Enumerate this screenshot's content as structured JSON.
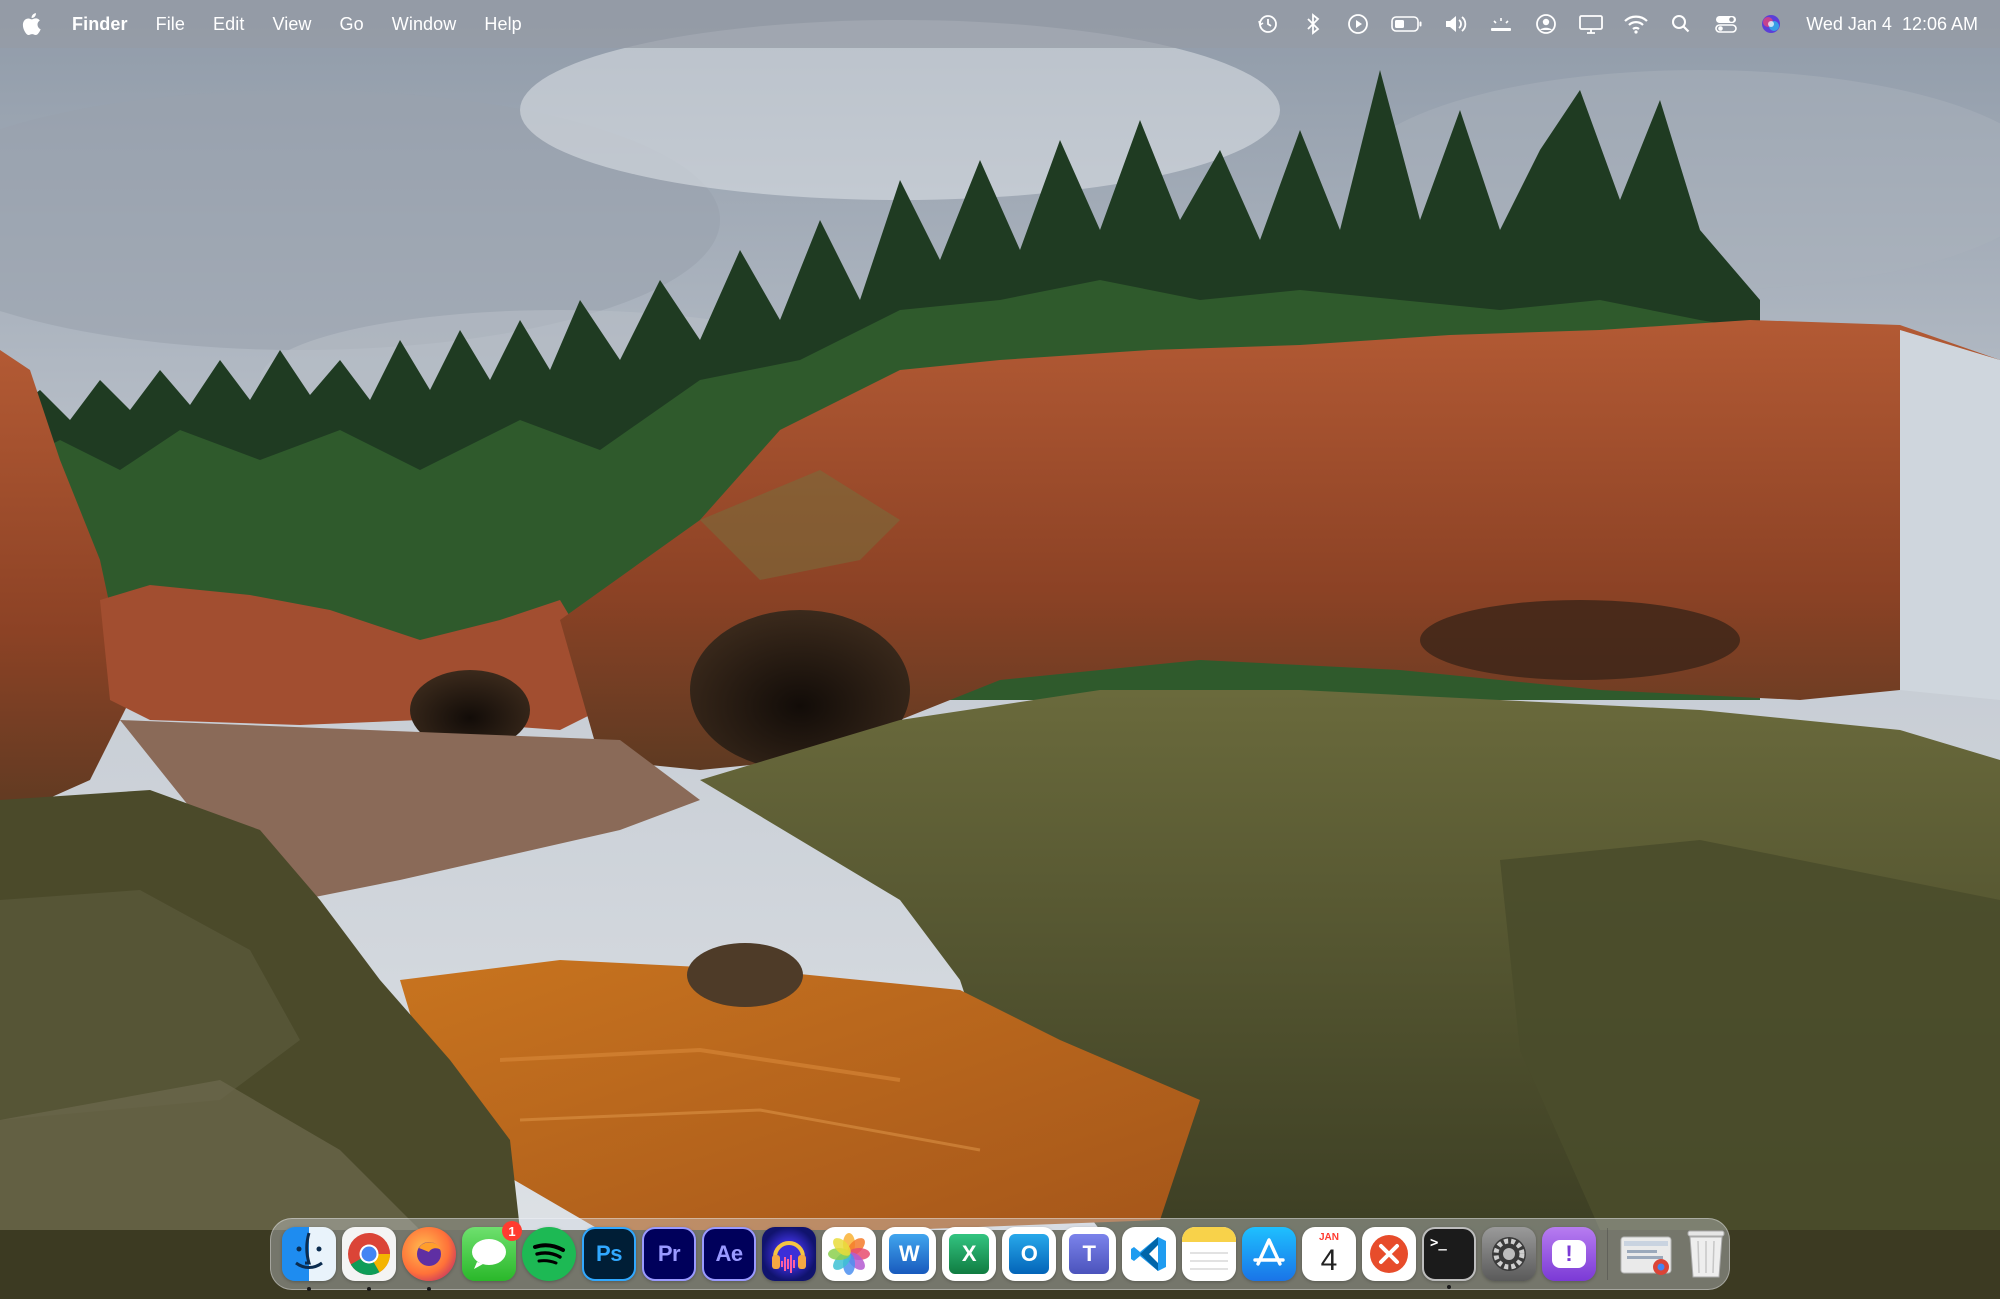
{
  "menubar": {
    "apple_icon": "apple-logo-icon",
    "app_name": "Finder",
    "menus": [
      "File",
      "Edit",
      "View",
      "Go",
      "Window",
      "Help"
    ],
    "status_icons": [
      "time-machine-icon",
      "bluetooth-icon",
      "play-circle-icon",
      "battery-icon",
      "volume-icon",
      "keyboard-brightness-icon",
      "user-account-icon",
      "display-icon",
      "wifi-icon",
      "spotlight-search-icon",
      "control-center-icon",
      "siri-icon"
    ],
    "clock": {
      "date": "Wed Jan 4",
      "time": "12:06 AM"
    }
  },
  "dock": {
    "apps": [
      {
        "name": "Finder",
        "icon": "finder-icon",
        "running": true
      },
      {
        "name": "Google Chrome",
        "icon": "chrome-icon",
        "running": true
      },
      {
        "name": "Firefox",
        "icon": "firefox-icon",
        "running": true
      },
      {
        "name": "Messages",
        "icon": "messages-icon",
        "running": false,
        "badge": "1"
      },
      {
        "name": "Spotify",
        "icon": "spotify-icon",
        "running": false
      },
      {
        "name": "Photoshop",
        "icon": "photoshop-icon",
        "running": false,
        "label": "Ps"
      },
      {
        "name": "Premiere Pro",
        "icon": "premiere-icon",
        "running": false,
        "label": "Pr"
      },
      {
        "name": "After Effects",
        "icon": "after-effects-icon",
        "running": false,
        "label": "Ae"
      },
      {
        "name": "Audition",
        "icon": "audition-icon",
        "running": false
      },
      {
        "name": "Photos",
        "icon": "photos-icon",
        "running": false
      },
      {
        "name": "Word",
        "icon": "word-icon",
        "running": false,
        "label": "W"
      },
      {
        "name": "Excel",
        "icon": "excel-icon",
        "running": false,
        "label": "X"
      },
      {
        "name": "Outlook",
        "icon": "outlook-icon",
        "running": false,
        "label": "O"
      },
      {
        "name": "Teams",
        "icon": "teams-icon",
        "running": false,
        "label": "T"
      },
      {
        "name": "Visual Studio Code",
        "icon": "vscode-icon",
        "running": false
      },
      {
        "name": "Notes",
        "icon": "notes-icon",
        "running": false
      },
      {
        "name": "App Store",
        "icon": "app-store-icon",
        "running": false
      },
      {
        "name": "Calendar",
        "icon": "calendar-icon",
        "running": false,
        "cal_month": "JAN",
        "cal_day": "4"
      },
      {
        "name": "Remote Desktop",
        "icon": "remote-desktop-icon",
        "running": false
      },
      {
        "name": "Terminal",
        "icon": "terminal-icon",
        "running": true,
        "label": ">_"
      },
      {
        "name": "System Settings",
        "icon": "system-settings-icon",
        "running": false
      },
      {
        "name": "Feedback Assistant",
        "icon": "feedback-icon",
        "running": false,
        "label": "!"
      }
    ],
    "extras": [
      {
        "name": "Downloads",
        "icon": "downloads-stack-icon"
      },
      {
        "name": "Trash",
        "icon": "trash-icon"
      }
    ]
  }
}
